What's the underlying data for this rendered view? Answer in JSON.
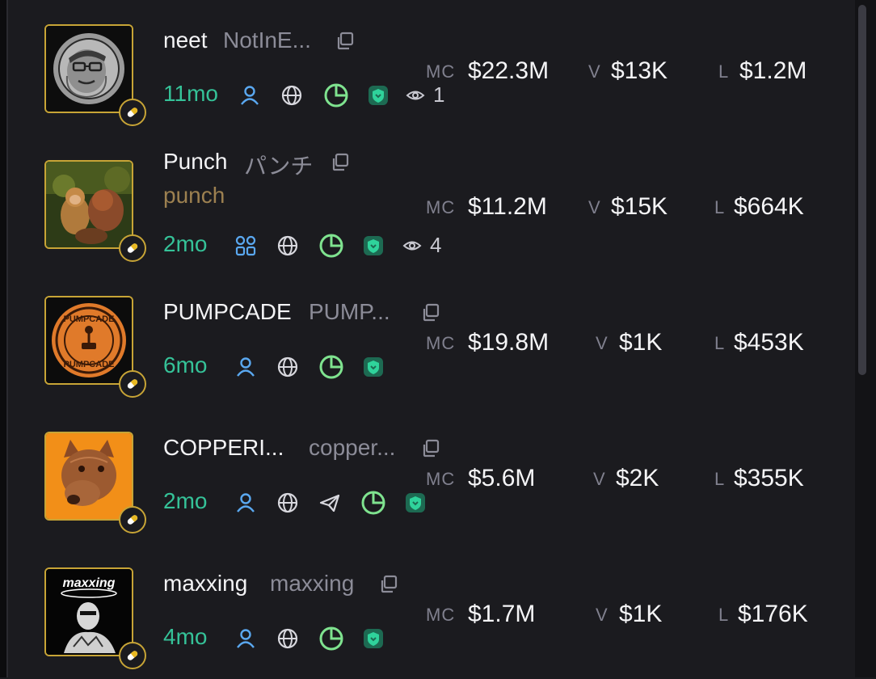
{
  "tokens": [
    {
      "name": "neet",
      "ticker": "NotInE...",
      "subname": "",
      "age": "11mo",
      "viewers": "1",
      "mc_label": "MC",
      "mc": "$22.3M",
      "v_label": "V",
      "v": "$13K",
      "l_label": "L",
      "l": "$1.2M"
    },
    {
      "name": "Punch",
      "ticker": "パンチ",
      "subname": "punch",
      "age": "2mo",
      "viewers": "4",
      "mc_label": "MC",
      "mc": "$11.2M",
      "v_label": "V",
      "v": "$15K",
      "l_label": "L",
      "l": "$664K"
    },
    {
      "name": "PUMPCADE",
      "ticker": "PUMP...",
      "subname": "",
      "age": "6mo",
      "viewers": "",
      "mc_label": "MC",
      "mc": "$19.8M",
      "v_label": "V",
      "v": "$1K",
      "l_label": "L",
      "l": "$453K",
      "logo_text": "PUMPCADE"
    },
    {
      "name": "COPPERI...",
      "ticker": "copper...",
      "subname": "",
      "age": "2mo",
      "viewers": "",
      "mc_label": "MC",
      "mc": "$5.6M",
      "v_label": "V",
      "v": "$2K",
      "l_label": "L",
      "l": "$355K"
    },
    {
      "name": "maxxing",
      "ticker": "maxxing",
      "subname": "",
      "age": "4mo",
      "viewers": "",
      "mc_label": "MC",
      "mc": "$1.7M",
      "v_label": "V",
      "v": "$1K",
      "l_label": "L",
      "l": "$176K",
      "logo_text": "maxxing"
    }
  ],
  "colors": {
    "age": "#35c298",
    "avatar_border": "#c7a436",
    "user_icon": "#5aa8f0",
    "pie_icon": "#7fe38f",
    "shield_icon": "#2fd39b"
  },
  "icons": [
    "copy-icon",
    "user-icon",
    "users-icon",
    "globe-icon",
    "telegram-icon",
    "pie-chart-icon",
    "shield-icon",
    "eye-icon",
    "pill-icon"
  ]
}
